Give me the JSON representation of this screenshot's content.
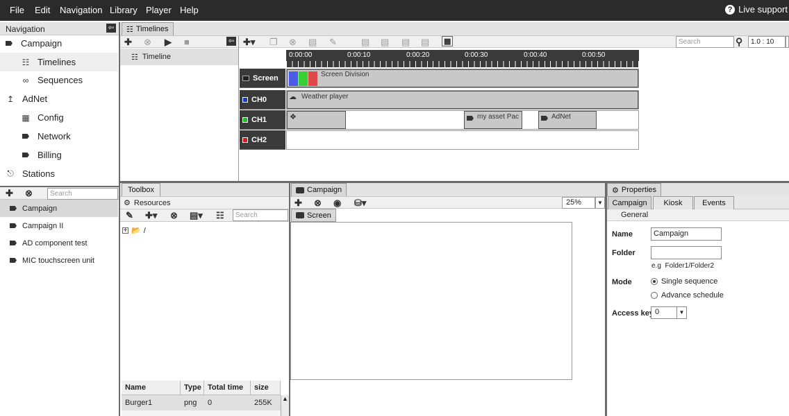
{
  "menu": {
    "items": [
      "File",
      "Edit",
      "Navigation",
      "Library",
      "Player",
      "Help"
    ],
    "live_support": "Live support"
  },
  "navigation": {
    "title": "Navigation",
    "items": [
      {
        "label": "Campaign",
        "icon": "tag-icon"
      },
      {
        "label": "Timelines",
        "icon": "timeline-icon"
      },
      {
        "label": "Sequences",
        "icon": "infinity-icon"
      },
      {
        "label": "AdNet",
        "icon": "upload-icon"
      },
      {
        "label": "Config",
        "icon": "grid-icon"
      },
      {
        "label": "Network",
        "icon": "tag-icon"
      },
      {
        "label": "Billing",
        "icon": "tag-icon"
      },
      {
        "label": "Stations",
        "icon": "network-icon"
      }
    ],
    "search_placeholder": "Search",
    "campaigns": [
      "Campaign",
      "Campaign II",
      "AD component test",
      "MIC touchscreen unit"
    ]
  },
  "timelines": {
    "tab": "Timelines",
    "item": "Timeline",
    "search_placeholder": "Search",
    "zoom": "1.0 : 10",
    "ticks": [
      "0:00:00",
      "0:00:10",
      "0:00:20",
      "0:00:30",
      "0:00:40",
      "0:00:50"
    ],
    "tracks": [
      {
        "label": "Screen",
        "color": "#222222"
      },
      {
        "label": "CH0",
        "color": "#1a3bd6"
      },
      {
        "label": "CH1",
        "color": "#1fc21f"
      },
      {
        "label": "CH2",
        "color": "#d61a1a"
      }
    ],
    "clips": {
      "screen_division": "Screen Division",
      "weather": "Weather player",
      "asset": "my asset Pac",
      "adnet": "AdNet"
    }
  },
  "toolbox": {
    "tab": "Toolbox",
    "resources": "Resources",
    "search_placeholder": "Search",
    "tree_root": "/",
    "columns": [
      "Name",
      "Type",
      "Total time",
      "size"
    ],
    "rows": [
      {
        "name": "Burger1",
        "type": "png",
        "time": "0",
        "size": "255K"
      }
    ]
  },
  "campaign": {
    "tab": "Campaign",
    "zoom": "25%",
    "screen_tab": "Screen"
  },
  "properties": {
    "tab": "Properties",
    "tabs": [
      "Campaign",
      "Kiosk",
      "Events"
    ],
    "section": "General",
    "name_label": "Name",
    "name_value": "Campaign",
    "folder_label": "Folder",
    "folder_value": "",
    "folder_hint": "e.g  Folder1/Folder2",
    "mode_label": "Mode",
    "mode_options": [
      "Single sequence",
      "Advance schedule"
    ],
    "access_label": "Access key",
    "access_value": "0"
  }
}
